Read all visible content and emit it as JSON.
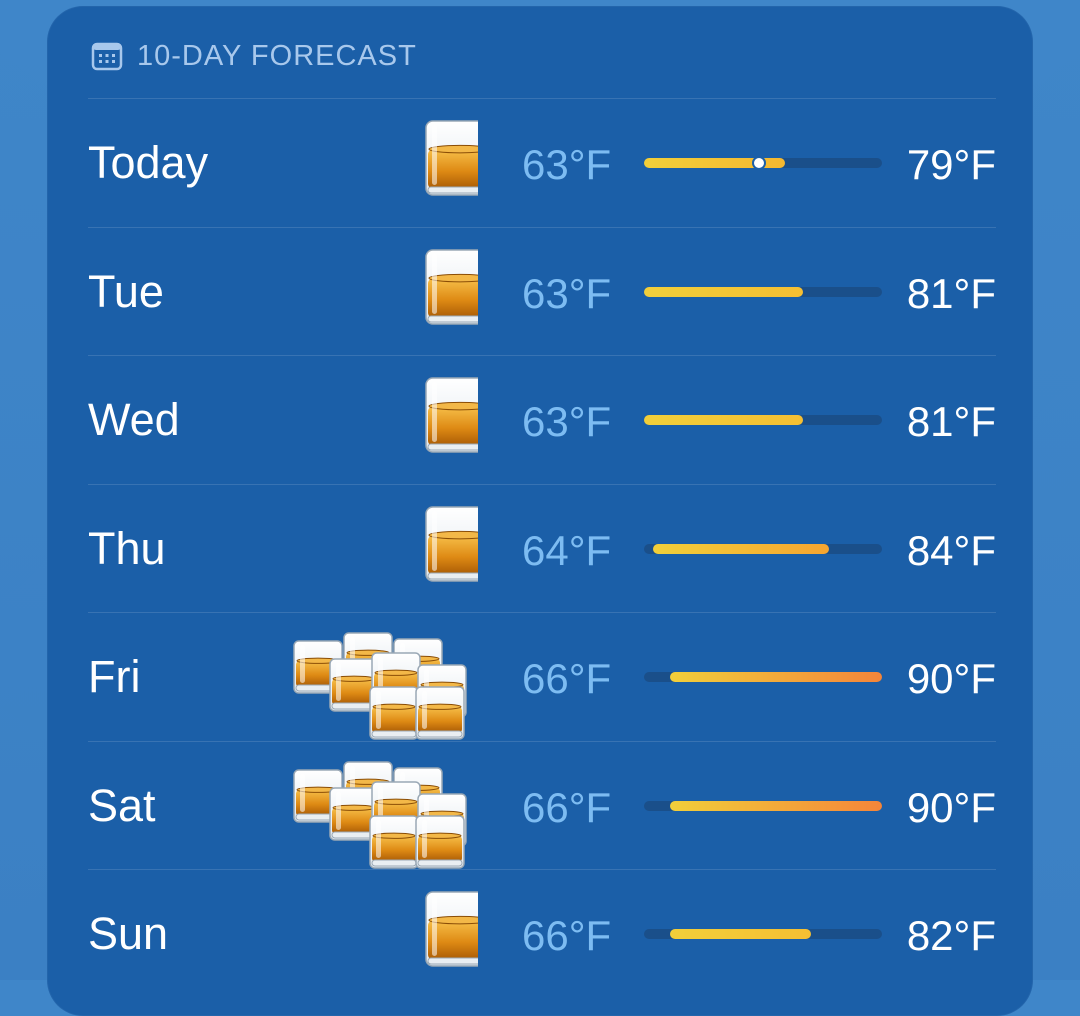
{
  "header": {
    "title": "10-DAY FORECAST",
    "icon": "calendar-icon"
  },
  "scale": {
    "min": 63,
    "max": 90
  },
  "days": [
    {
      "label": "Today",
      "icon": "whiskey-glass-icon",
      "low": "63°F",
      "high": "79°F",
      "low_val": 63,
      "high_val": 79,
      "current_val": 76,
      "colors": [
        "#f2cf3a",
        "#f5b830"
      ]
    },
    {
      "label": "Tue",
      "icon": "whiskey-glass-icon",
      "low": "63°F",
      "high": "81°F",
      "low_val": 63,
      "high_val": 81,
      "colors": [
        "#f2cf3a",
        "#f5bf33"
      ]
    },
    {
      "label": "Wed",
      "icon": "whiskey-glass-icon",
      "low": "63°F",
      "high": "81°F",
      "low_val": 63,
      "high_val": 81,
      "colors": [
        "#f2cf3a",
        "#f5bf33"
      ]
    },
    {
      "label": "Thu",
      "icon": "whiskey-glass-icon",
      "low": "64°F",
      "high": "84°F",
      "low_val": 64,
      "high_val": 84,
      "colors": [
        "#f2d03a",
        "#f6a530"
      ]
    },
    {
      "label": "Fri",
      "icon": "whiskey-glasses-cluster-icon",
      "low": "66°F",
      "high": "90°F",
      "low_val": 66,
      "high_val": 90,
      "colors": [
        "#f2cf3a",
        "#f4853a"
      ]
    },
    {
      "label": "Sat",
      "icon": "whiskey-glasses-cluster-icon",
      "low": "66°F",
      "high": "90°F",
      "low_val": 66,
      "high_val": 90,
      "colors": [
        "#f2cf3a",
        "#f4853a"
      ]
    },
    {
      "label": "Sun",
      "icon": "whiskey-glass-icon",
      "low": "66°F",
      "high": "82°F",
      "low_val": 66,
      "high_val": 82,
      "colors": [
        "#f2cf3a",
        "#f5bf33"
      ]
    }
  ]
}
